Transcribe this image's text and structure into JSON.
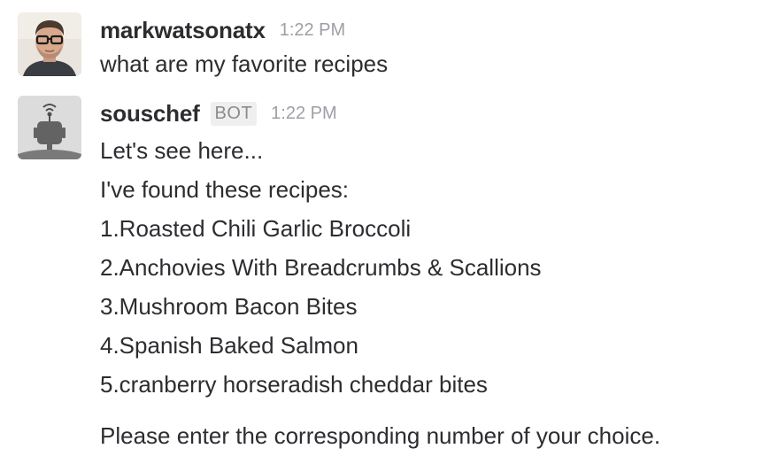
{
  "messages": {
    "user": {
      "username": "markwatsonatx",
      "timestamp": "1:22 PM",
      "avatar_icon": "user-photo",
      "text": "what are my favorite recipes"
    },
    "bot": {
      "username": "souschef",
      "badge": "BOT",
      "timestamp": "1:22 PM",
      "avatar_icon": "robot-icon",
      "intro": "Let's see here...",
      "found": "I've found these recipes:",
      "recipes": [
        "1.Roasted Chili Garlic Broccoli",
        "2.Anchovies With Breadcrumbs & Scallions",
        "3.Mushroom Bacon Bites",
        "4.Spanish Baked Salmon",
        "5.cranberry horseradish cheddar bites"
      ],
      "prompt": "Please enter the corresponding number of your choice."
    }
  }
}
